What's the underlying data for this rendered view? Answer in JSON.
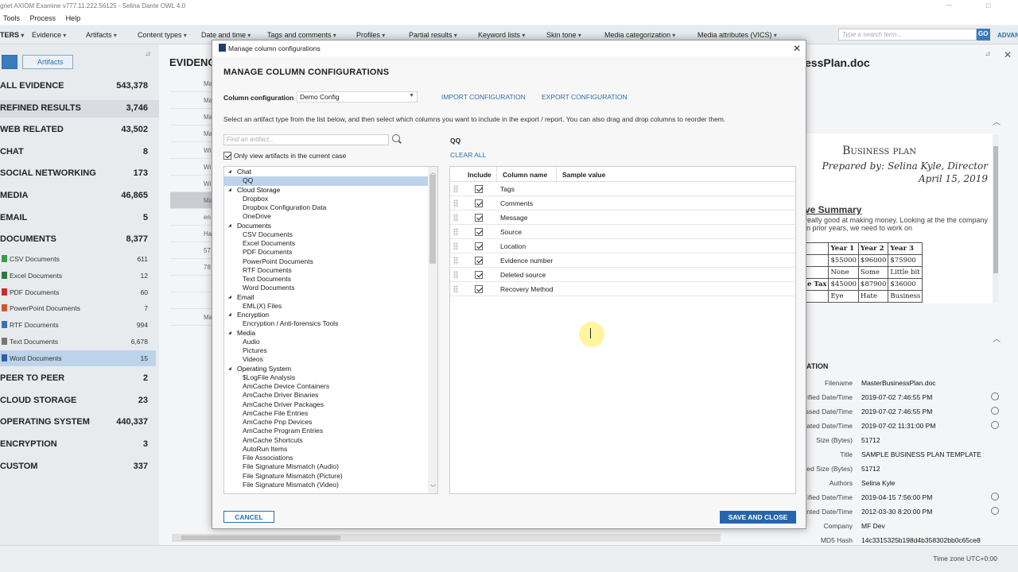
{
  "app": {
    "title": "gnet AXIOM Examine v777.11.222.56125 - Selina Dante OWL 4.0",
    "menu": [
      "Tools",
      "Process",
      "Help"
    ],
    "filters_label": "TERS",
    "filters": [
      "Evidence",
      "Artifacts",
      "Content types",
      "Date and time",
      "Tags and comments",
      "Profiles",
      "Partial results",
      "Keyword lists",
      "Skin tone",
      "Media categorization",
      "Media attributes (VICS)"
    ],
    "search_placeholder": "Type a search term...",
    "go_label": "GO",
    "advanced_label": "ADVAN",
    "artifacts_button": "Artifacts",
    "status_timezone": "Time zone  UTC+0:00"
  },
  "left_pane": {
    "categories": [
      {
        "label": "ALL EVIDENCE",
        "count": "543,378"
      },
      {
        "label": "REFINED RESULTS",
        "count": "3,746",
        "selected": true
      },
      {
        "label": "WEB RELATED",
        "count": "43,502"
      },
      {
        "label": "CHAT",
        "count": "8"
      },
      {
        "label": "SOCIAL NETWORKING",
        "count": "173"
      },
      {
        "label": "MEDIA",
        "count": "46,865"
      },
      {
        "label": "EMAIL",
        "count": "5"
      },
      {
        "label": "DOCUMENTS",
        "count": "8,377"
      }
    ],
    "documents": [
      {
        "label": "CSV Documents",
        "count": "611",
        "color": "#3a9a4a"
      },
      {
        "label": "Excel Documents",
        "count": "12",
        "color": "#2f7a3b"
      },
      {
        "label": "PDF Documents",
        "count": "60",
        "color": "#c8302c"
      },
      {
        "label": "PowerPoint Documents",
        "count": "7",
        "color": "#d2572b"
      },
      {
        "label": "RTF Documents",
        "count": "994",
        "color": "#3c6fb8"
      },
      {
        "label": "Text Documents",
        "count": "6,678",
        "color": "#777777"
      },
      {
        "label": "Word Documents",
        "count": "15",
        "color": "#2b5fae",
        "selected": true
      }
    ],
    "more_categories": [
      {
        "label": "PEER TO PEER",
        "count": "2"
      },
      {
        "label": "CLOUD STORAGE",
        "count": "23"
      },
      {
        "label": "OPERATING SYSTEM",
        "count": "440,337"
      },
      {
        "label": "ENCRYPTION",
        "count": "3"
      },
      {
        "label": "CUSTOM",
        "count": "337"
      }
    ]
  },
  "middle_pane": {
    "title": "EVIDENC",
    "column_header": "F",
    "rows": [
      "Ma",
      "Ma",
      "Ma",
      "Ma",
      "Wi",
      "Wi",
      "Wi",
      "Ma",
      "en",
      "Ha",
      "57",
      "78",
      "",
      "",
      "Ma"
    ]
  },
  "right_pane": {
    "title": "essPlan.doc",
    "preview": {
      "title": "Business plan",
      "prepared_by": "Prepared by: Selina Kyle, Director",
      "date": "April 15, 2019",
      "summary_heading": "ve Summary",
      "body": "really good at making money. Looking at the the company in prior years, we need to work on",
      "table": [
        [
          "",
          "Year 1",
          "Year 2",
          "Year 3"
        ],
        [
          "",
          "$55000",
          "$96000",
          "$75900"
        ],
        [
          "",
          "None",
          "Some",
          "Little bit"
        ],
        [
          "e Tax",
          "$45000",
          "$87900",
          "$36000"
        ],
        [
          "",
          "Eye",
          "Hate",
          "Business"
        ]
      ]
    },
    "properties_heading": "ATION",
    "properties": [
      {
        "key": "Filename",
        "value": "MasterBusinessPlan.doc",
        "clock": false
      },
      {
        "key": "ified Date/Time",
        "value": "2019-07-02 7:46:55 PM",
        "clock": true
      },
      {
        "key": "ssed Date/Time",
        "value": "2019-07-02 7:46:55 PM",
        "clock": true
      },
      {
        "key": "ated Date/Time",
        "value": "2019-07-02 11:31:00 PM",
        "clock": true
      },
      {
        "key": "Size (Bytes)",
        "value": "51712",
        "clock": false
      },
      {
        "key": "Title",
        "value": "SAMPLE BUSINESS PLAN TEMPLATE",
        "clock": false
      },
      {
        "key": "ved Size (Bytes)",
        "value": "51712",
        "clock": false
      },
      {
        "key": "Authors",
        "value": "Selina Kyle",
        "clock": false
      },
      {
        "key": "ified Date/Time",
        "value": "2019-04-15 7:56:00 PM",
        "clock": true
      },
      {
        "key": "nted Date/Time",
        "value": "2012-03-30 8:20:00 PM",
        "clock": true
      },
      {
        "key": "Company",
        "value": "MF Dev",
        "clock": false
      },
      {
        "key": "MD5 Hash",
        "value": "14c3315325b198d4b358302bb0c65ce8",
        "clock": false
      }
    ]
  },
  "dialog": {
    "window_title": "Manage column configurations",
    "heading": "MANAGE COLUMN CONFIGURATIONS",
    "config_label": "Column configuration",
    "config_value": "Demo Config",
    "import_label": "IMPORT CONFIGURATION",
    "export_label": "EXPORT CONFIGURATION",
    "instructions": "Select an artifact type from the list below, and then select which columns you want to include in the export / report. You can also drag and drop columns to reorder them.",
    "find_placeholder": "Find an artifact...",
    "only_view_label": "Only view artifacts in the current case",
    "only_view_checked": true,
    "tree": [
      {
        "type": "group",
        "label": "Chat"
      },
      {
        "type": "item",
        "label": "QQ",
        "selected": true
      },
      {
        "type": "group",
        "label": "Cloud Storage"
      },
      {
        "type": "item",
        "label": "Dropbox"
      },
      {
        "type": "item",
        "label": "Dropbox Configuration Data"
      },
      {
        "type": "item",
        "label": "OneDrive"
      },
      {
        "type": "group",
        "label": "Documents"
      },
      {
        "type": "item",
        "label": "CSV Documents"
      },
      {
        "type": "item",
        "label": "Excel Documents"
      },
      {
        "type": "item",
        "label": "PDF Documents"
      },
      {
        "type": "item",
        "label": "PowerPoint Documents"
      },
      {
        "type": "item",
        "label": "RTF Documents"
      },
      {
        "type": "item",
        "label": "Text Documents"
      },
      {
        "type": "item",
        "label": "Word Documents"
      },
      {
        "type": "group",
        "label": "Email"
      },
      {
        "type": "item",
        "label": "EML(X) Files"
      },
      {
        "type": "group",
        "label": "Encryption"
      },
      {
        "type": "item",
        "label": "Encryption / Anti-forensics Tools"
      },
      {
        "type": "group",
        "label": "Media"
      },
      {
        "type": "item",
        "label": "Audio"
      },
      {
        "type": "item",
        "label": "Pictures"
      },
      {
        "type": "item",
        "label": "Videos"
      },
      {
        "type": "group",
        "label": "Operating System"
      },
      {
        "type": "item",
        "label": "$LogFile Analysis"
      },
      {
        "type": "item",
        "label": "AmCache Device Containers"
      },
      {
        "type": "item",
        "label": "AmCache Driver Binaries"
      },
      {
        "type": "item",
        "label": "AmCache Driver Packages"
      },
      {
        "type": "item",
        "label": "AmCache File Entries"
      },
      {
        "type": "item",
        "label": "AmCache Pnp Devices"
      },
      {
        "type": "item",
        "label": "AmCache Program Entries"
      },
      {
        "type": "item",
        "label": "AmCache Shortcuts"
      },
      {
        "type": "item",
        "label": "AutoRun Items"
      },
      {
        "type": "item",
        "label": "File Associations"
      },
      {
        "type": "item",
        "label": "File Signature Mismatch (Audio)"
      },
      {
        "type": "item",
        "label": "File Signature Mismatch (Picture)"
      },
      {
        "type": "item",
        "label": "File Signature Mismatch (Video)"
      }
    ],
    "selected_artifact": "QQ",
    "clear_all_label": "CLEAR ALL",
    "columns_header": {
      "include": "Include",
      "column_name": "Column name",
      "sample_value": "Sample value"
    },
    "columns": [
      {
        "name": "Tags",
        "included": true
      },
      {
        "name": "Comments",
        "included": true
      },
      {
        "name": "Message",
        "included": true
      },
      {
        "name": "Source",
        "included": true
      },
      {
        "name": "Location",
        "included": true
      },
      {
        "name": "Evidence number",
        "included": true
      },
      {
        "name": "Deleted source",
        "included": true
      },
      {
        "name": "Recovery Method",
        "included": true
      }
    ],
    "cancel_label": "CANCEL",
    "save_label": "SAVE AND CLOSE"
  }
}
